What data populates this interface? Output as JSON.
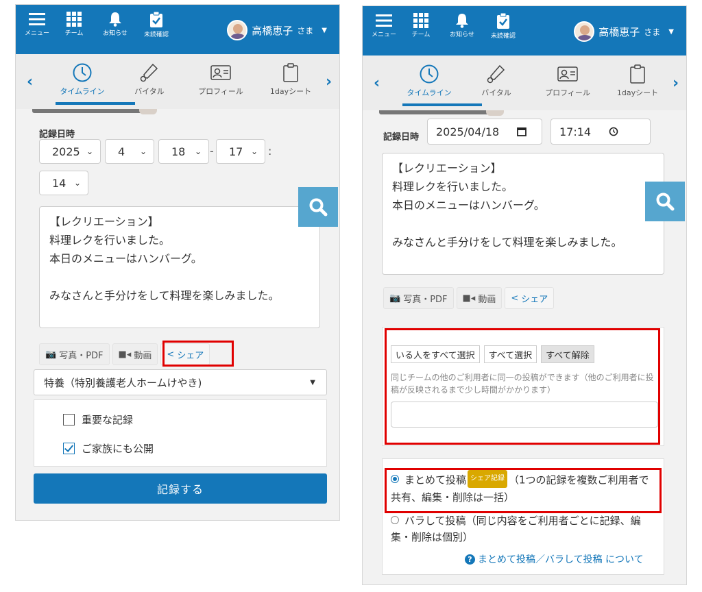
{
  "topbar": {
    "menu_label": "メニュー",
    "team_label": "チーム",
    "notice_label": "お知らせ",
    "unread_label": "未読確認",
    "user_name": "高橋恵子",
    "user_suffix": "さま"
  },
  "tabs": [
    {
      "label": "タイムライン",
      "icon": "clock-icon"
    },
    {
      "label": "バイタル",
      "icon": "thermometer-icon"
    },
    {
      "label": "プロフィール",
      "icon": "profile-card-icon"
    },
    {
      "label": "1dayシート",
      "icon": "clipboard-icon"
    }
  ],
  "left": {
    "record_datetime_label": "記録日時",
    "year": "2025",
    "month": "4",
    "day": "18",
    "hour": "17",
    "minute": "14",
    "dash": "-",
    "colon": ":",
    "note_text": "【レクリエーション】\n料理レクを行いました。\n本日のメニューはハンバーグ。\n\nみなさんと手分けをして料理を楽しみました。",
    "photo_btn": "写真・PDF",
    "video_btn": "動画",
    "share_btn": "シェア",
    "facility": "特養（特別養護老人ホームけやき)",
    "important_label": "重要な記録",
    "family_label": "ご家族にも公開",
    "submit_label": "記録する"
  },
  "right": {
    "record_datetime_label": "記録日時",
    "date_value": "2025/04/18",
    "time_value": "17:14",
    "note_text": "【レクリエーション】\n料理レクを行いました。\n本日のメニューはハンバーグ。\n\nみなさんと手分けをして料理を楽しみました。",
    "photo_btn": "写真・PDF",
    "video_btn": "動画",
    "share_btn": "シェア",
    "select_present_btn": "いる人をすべて選択",
    "select_all_btn": "すべて選択",
    "deselect_all_btn": "すべて解除",
    "help_text": "同じチームの他のご利用者に同一の投稿ができます（他のご利用者に投稿が反映されるまで少し時間がかかります）",
    "bulk_post_label": "まとめて投稿",
    "share_badge": "シェア記録",
    "bulk_post_desc": "（1つの記録を複数ご利用者で共有、編集・削除は一括）",
    "separate_post_label": "バラして投稿",
    "separate_post_desc": "（同じ内容をご利用者ごとに記録、編集・削除は個別）",
    "help_link": "まとめて投稿／バラして投稿 について"
  },
  "colors": {
    "primary": "#1477b9",
    "highlight": "#e00000",
    "search_button": "#56a6cf",
    "badge": "#d9a800"
  }
}
